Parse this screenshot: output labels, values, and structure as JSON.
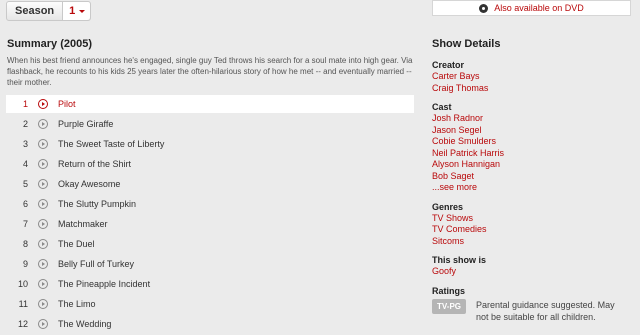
{
  "season": {
    "label": "Season",
    "selected": "1"
  },
  "dvd": {
    "label": "Also available on DVD"
  },
  "summary": {
    "title": "Summary (2005)",
    "text": "When his best friend announces he's engaged, single guy Ted throws his search for a soul mate into high gear. Via flashback, he recounts to his kids 25 years later the often-hilarious story of how he met -- and eventually married -- their mother."
  },
  "episodes": [
    {
      "num": "1",
      "title": "Pilot"
    },
    {
      "num": "2",
      "title": "Purple Giraffe"
    },
    {
      "num": "3",
      "title": "The Sweet Taste of Liberty"
    },
    {
      "num": "4",
      "title": "Return of the Shirt"
    },
    {
      "num": "5",
      "title": "Okay Awesome"
    },
    {
      "num": "6",
      "title": "The Slutty Pumpkin"
    },
    {
      "num": "7",
      "title": "Matchmaker"
    },
    {
      "num": "8",
      "title": "The Duel"
    },
    {
      "num": "9",
      "title": "Belly Full of Turkey"
    },
    {
      "num": "10",
      "title": "The Pineapple Incident"
    },
    {
      "num": "11",
      "title": "The Limo"
    },
    {
      "num": "12",
      "title": "The Wedding"
    }
  ],
  "details": {
    "title": "Show Details",
    "creator_label": "Creator",
    "creators": [
      "Carter Bays",
      "Craig Thomas"
    ],
    "cast_label": "Cast",
    "cast": [
      "Josh Radnor",
      "Jason Segel",
      "Cobie Smulders",
      "Neil Patrick Harris",
      "Alyson Hannigan",
      "Bob Saget"
    ],
    "see_more": "...see more",
    "genres_label": "Genres",
    "genres": [
      "TV Shows",
      "TV Comedies",
      "Sitcoms"
    ],
    "this_show_label": "This show is",
    "this_show": [
      "Goofy"
    ],
    "ratings_label": "Ratings",
    "rating_badge": "TV-PG",
    "rating_desc": "Parental guidance suggested. May not be suitable for all children."
  },
  "colors": {
    "accent": "#b9090b",
    "background": "#ebebeb"
  }
}
